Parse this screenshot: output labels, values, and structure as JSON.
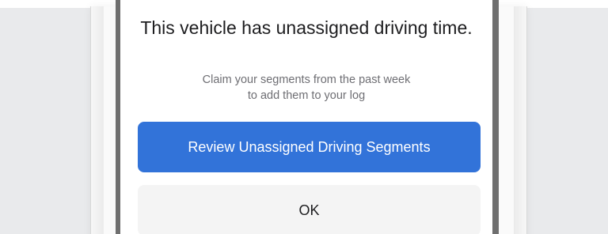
{
  "dialog": {
    "title": "This vehicle has unassigned driving time.",
    "subtitle_line1": "Claim your segments from the past week",
    "subtitle_line2": "to add them to your log",
    "primary_button_label": "Review Unassigned Driving Segments",
    "secondary_button_label": "OK"
  },
  "colors": {
    "primary": "#3273d9",
    "secondary_bg": "#f4f4f4",
    "frame": "#6f6f6f",
    "background": "#e9eaec"
  }
}
